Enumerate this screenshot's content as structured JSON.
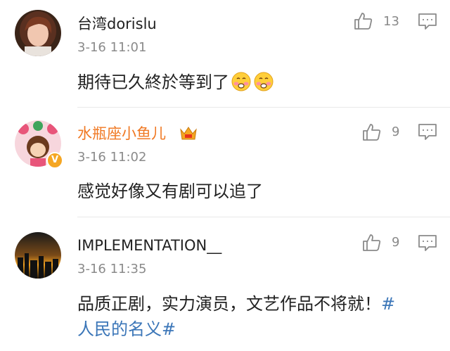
{
  "comments": [
    {
      "username": "台湾dorislu",
      "time": "3-16 11:01",
      "content": "期待已久終於等到了",
      "emoji": [
        "smiling-blushing-emoji",
        "smiling-blushing-emoji"
      ],
      "likes": "13",
      "username_color": "#222222"
    },
    {
      "username": "水瓶座小鱼儿",
      "time": "3-16 11:02",
      "content": "感觉好像又有剧可以追了",
      "likes": "9",
      "username_color": "#f07822",
      "verified_badge": "V"
    },
    {
      "username": "IMPLEMENTATION__",
      "time": "3-16 11:35",
      "content_line1": "品质正剧，实力演员，文艺作品不将就！",
      "hashtag_start": "#",
      "hashtag_line2": "人民的名义#",
      "likes": "9",
      "username_color": "#222222"
    }
  ],
  "colors": {
    "hashtag": "#3b76b8",
    "secondary_text": "#8a8a8a",
    "vip_orange": "#f07822"
  }
}
